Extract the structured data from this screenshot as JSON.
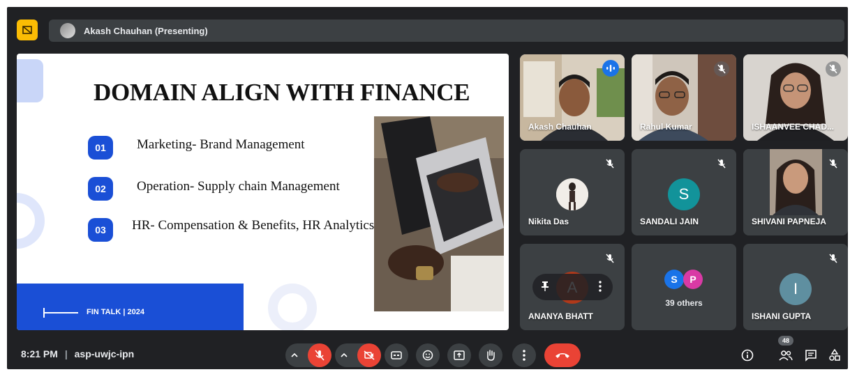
{
  "header": {
    "presenter_label": "Akash Chauhan (Presenting)"
  },
  "slide": {
    "title": "DOMAIN ALIGN WITH FINANCE",
    "items": [
      {
        "num": "01",
        "text": "Marketing- Brand Management"
      },
      {
        "num": "02",
        "text": "Operation- Supply chain Management"
      },
      {
        "num": "03",
        "text": "HR- Compensation & Benefits, HR Analytics"
      }
    ],
    "footer": "FIN TALK | 2024",
    "accent": "#1a4fd6"
  },
  "participants": [
    {
      "name": "Akash Chauhan",
      "kind": "video",
      "speaking": true
    },
    {
      "name": "Rahul Kumar",
      "kind": "video",
      "muted": true
    },
    {
      "name": "ISHAANVEE CHAD...",
      "kind": "video",
      "muted": true
    },
    {
      "name": "Nikita Das",
      "kind": "photo-avatar",
      "muted": true
    },
    {
      "name": "SANDALI JAIN",
      "kind": "letter-avatar",
      "initial": "S",
      "color": "#12939a",
      "muted": true
    },
    {
      "name": "SHIVANI PAPNEJA",
      "kind": "video",
      "muted": true
    },
    {
      "name": "ANANYA BHATT",
      "kind": "letter-avatar",
      "initial": "A",
      "color": "#b0391a",
      "muted": true
    },
    {
      "name": "39 others",
      "kind": "others",
      "initials": [
        "S",
        "P"
      ],
      "colors": [
        "#1a73e8",
        "#d93aa5"
      ]
    },
    {
      "name": "ISHANI GUPTA",
      "kind": "letter-avatar",
      "initial": "I",
      "color": "#5f8fa0",
      "muted": true
    }
  ],
  "bottombar": {
    "time": "8:21 PM",
    "separator": "|",
    "meeting_code": "asp-uwjc-ipn",
    "people_count": "48"
  },
  "icons": [
    "present-icon",
    "mic-off-icon",
    "cam-off-icon",
    "captions-icon",
    "emoji-icon",
    "present-screen-icon",
    "raise-hand-icon",
    "more-options-icon",
    "end-call-icon",
    "info-icon",
    "people-icon",
    "chat-icon",
    "activities-icon",
    "pin-icon"
  ]
}
